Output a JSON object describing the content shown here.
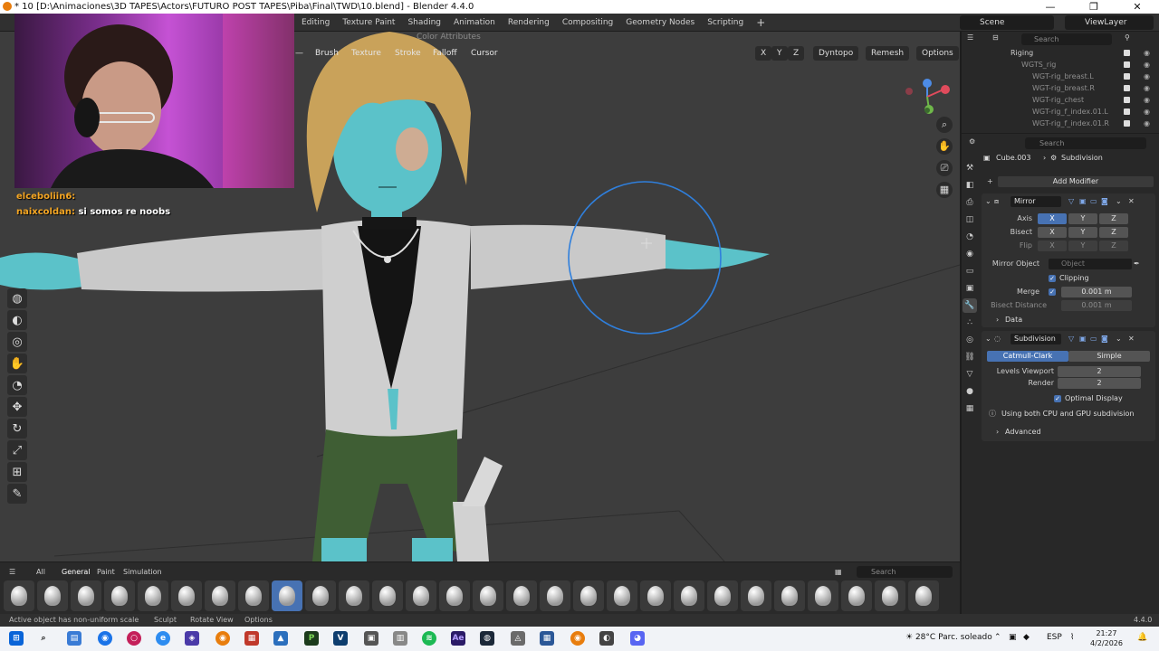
{
  "window": {
    "title": "* 10 [D:\\Animaciones\\3D TAPES\\Actors\\FUTURO POST TAPES\\Piba\\Final\\TWD\\10.blend] - Blender 4.4.0",
    "minimize": "—",
    "maximize": "❐",
    "close": "✕"
  },
  "topbar": {
    "workspaces": [
      "Editing",
      "Texture Paint",
      "Shading",
      "Animation",
      "Rendering",
      "Compositing",
      "Geometry Nodes",
      "Scripting"
    ],
    "add_workspace": "+",
    "scene": "Scene",
    "view_layer": "ViewLayer"
  },
  "viewport_header": {
    "menus": [
      "Brush",
      "Texture",
      "Stroke",
      "Falloff",
      "Cursor"
    ],
    "color_attributes": "Color Attributes",
    "symmetry_axes": [
      "X",
      "Y",
      "Z"
    ],
    "dyntopo": "Dyntopo",
    "remesh": "Remesh",
    "options": "Options"
  },
  "chat": [
    {
      "user": "elceboliin6:",
      "text": ""
    },
    {
      "user": "naixcoldan:",
      "text": "si somos re noobs"
    }
  ],
  "shelf": {
    "tabs": [
      "All",
      "General",
      "Paint",
      "Simulation"
    ],
    "active_tab": "General",
    "search_placeholder": "Search",
    "brush_count": 28,
    "active_brush_index": 8
  },
  "statusbar": {
    "message": "Active object has non-uniform scale",
    "hint_sculpt": "Sculpt",
    "hint_rotate": "Rotate View",
    "hint_options": "Options",
    "version": "4.4.0"
  },
  "outliner": {
    "search_placeholder": "Search",
    "rows": [
      {
        "label": "Riging",
        "indent": 0
      },
      {
        "label": "WGTS_rig",
        "indent": 1,
        "dim": true
      },
      {
        "label": "WGT-rig_breast.L",
        "indent": 2,
        "dim": true
      },
      {
        "label": "WGT-rig_breast.R",
        "indent": 2,
        "dim": true
      },
      {
        "label": "WGT-rig_chest",
        "indent": 2,
        "dim": true
      },
      {
        "label": "WGT-rig_f_index.01.L",
        "indent": 2,
        "dim": true
      },
      {
        "label": "WGT-rig_f_index.01.R",
        "indent": 2,
        "dim": true
      }
    ]
  },
  "properties": {
    "search_placeholder": "Search",
    "object_name": "Cube.003",
    "modifier_context": "Subdivision",
    "add_modifier": "Add Modifier",
    "mirror": {
      "name": "Mirror",
      "axis_label": "Axis",
      "bisect_label": "Bisect",
      "flip_label": "Flip",
      "axes": [
        "X",
        "Y",
        "Z"
      ],
      "mirror_object_label": "Mirror Object",
      "mirror_object_placeholder": "Object",
      "clipping_label": "Clipping",
      "merge_label": "Merge",
      "merge_value": "0.001 m",
      "bisect_distance_label": "Bisect Distance",
      "bisect_distance_value": "0.001 m",
      "data_label": "Data"
    },
    "subdivision": {
      "name": "Subdivision",
      "mode_catmull": "Catmull-Clark",
      "mode_simple": "Simple",
      "levels_viewport_label": "Levels Viewport",
      "levels_viewport_value": "2",
      "render_label": "Render",
      "render_value": "2",
      "optimal_display_label": "Optimal Display",
      "info_text": "Using both CPU and GPU subdivision",
      "advanced_label": "Advanced"
    }
  },
  "taskbar": {
    "weather_temp": "28°C",
    "weather_text": "Parc. soleado",
    "language": "ESP",
    "time": "21:27",
    "date": "4/2/2026"
  },
  "colors": {
    "accent": "#4772b3",
    "viewport": "#3d3d3d",
    "panel": "#303030",
    "brush_circle": "#2f7fdc",
    "skin": "#5bc2c9",
    "hair": "#c9a25a"
  }
}
